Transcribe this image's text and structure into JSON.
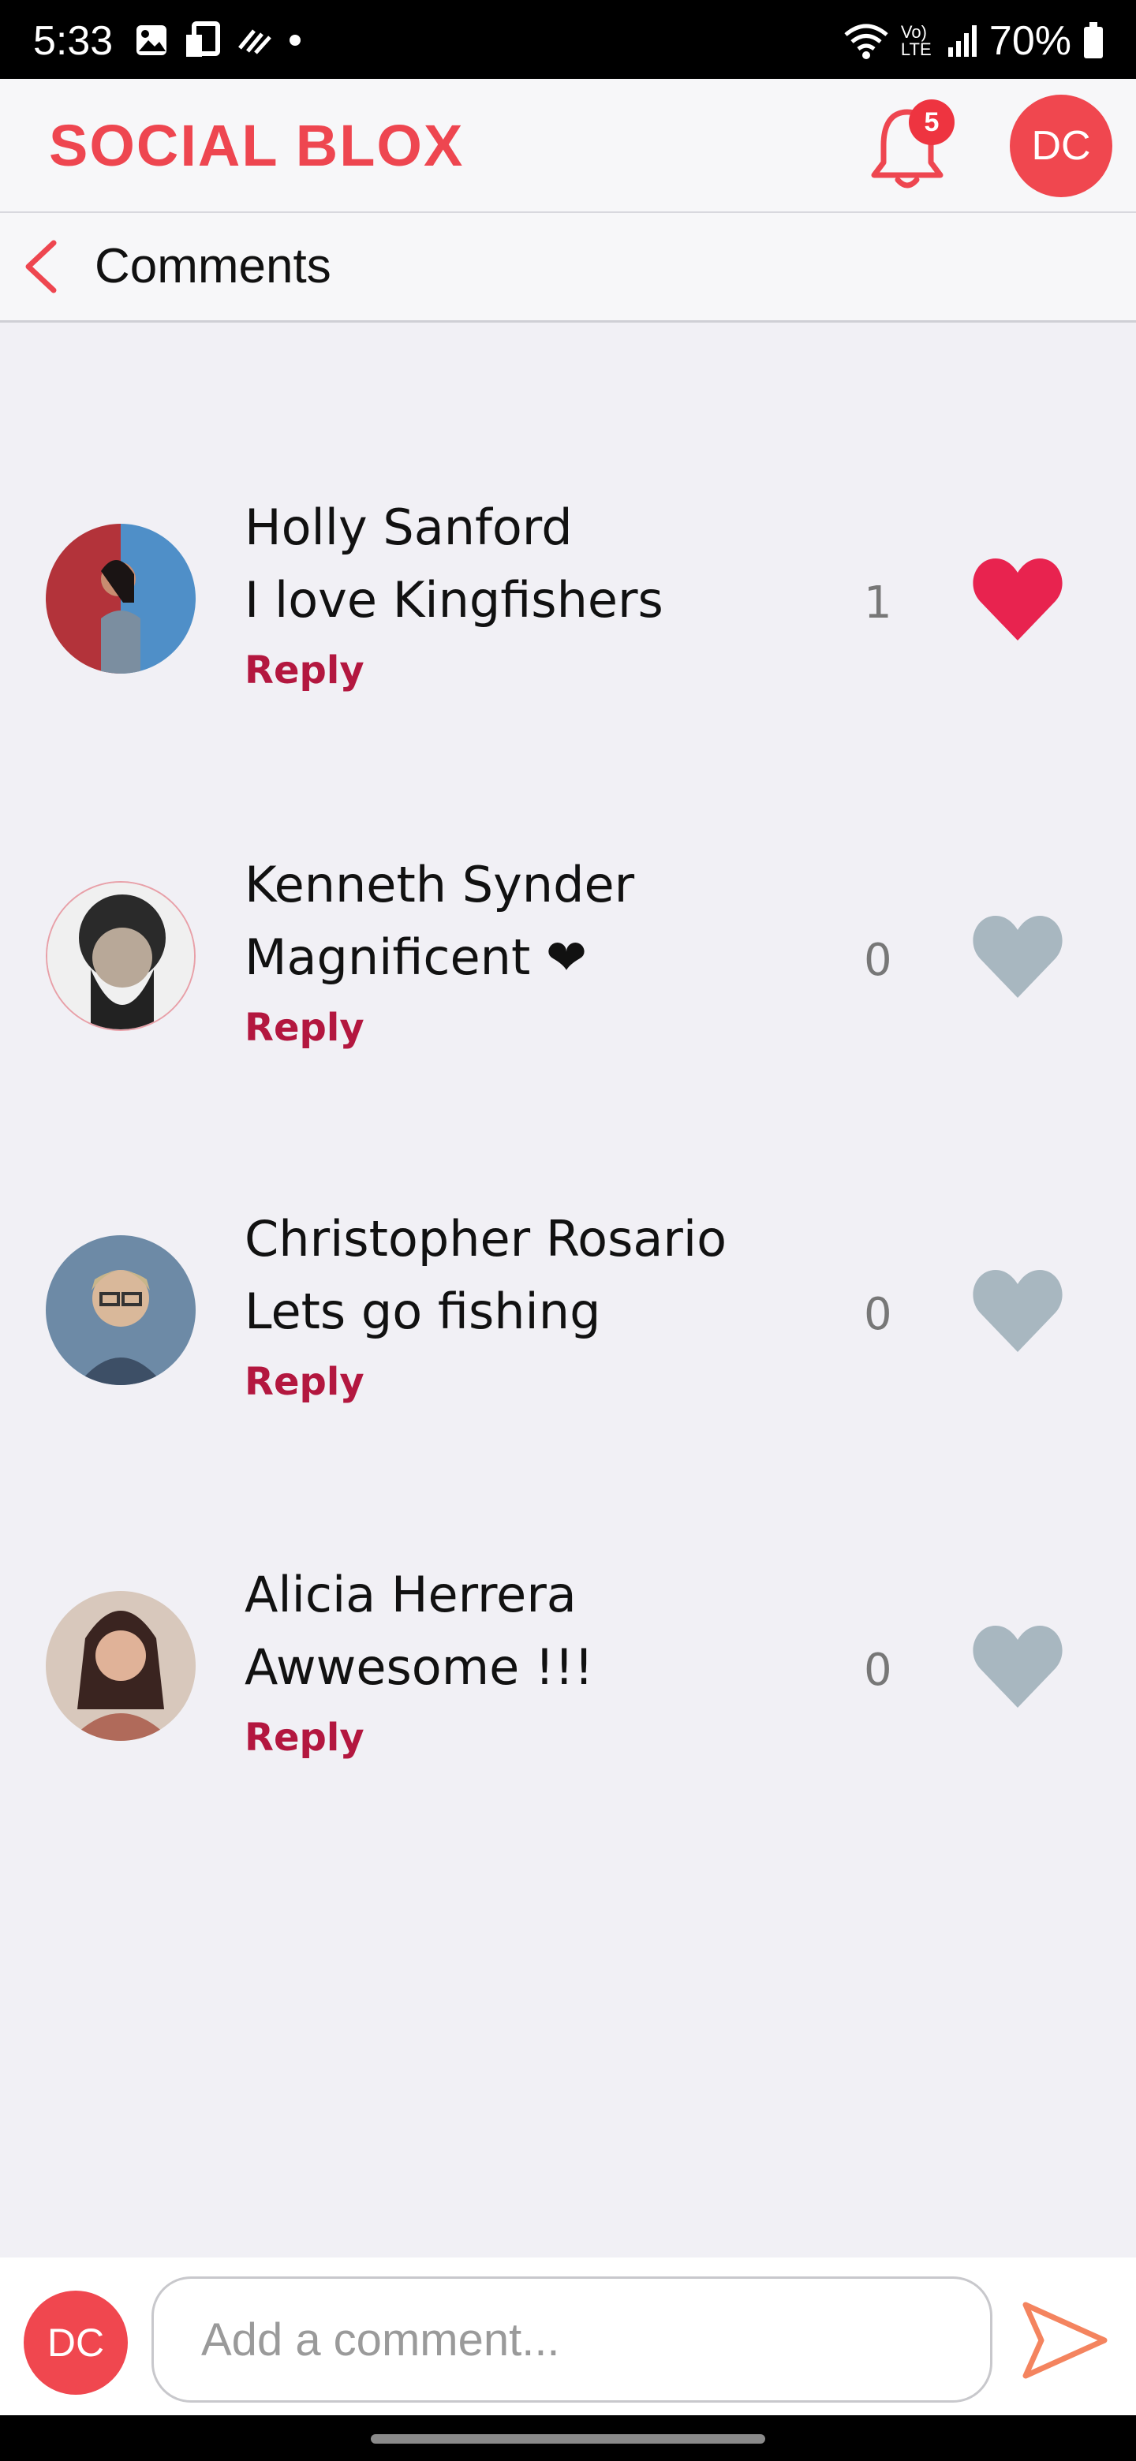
{
  "status": {
    "time": "5:33",
    "battery": "70%",
    "network": "Vo) LTE"
  },
  "header": {
    "logo": "SOCIAL BLOX",
    "notifications_count": "5",
    "user_initials": "DC"
  },
  "page": {
    "title": "Comments"
  },
  "comments": [
    {
      "name": "Holly Sanford",
      "text": "I love Kingfishers",
      "reply": "Reply",
      "likes": "1",
      "liked": true
    },
    {
      "name": "Kenneth Synder",
      "text": "Magnificent ❤",
      "reply": "Reply",
      "likes": "0",
      "liked": false
    },
    {
      "name": "Christopher Rosario",
      "text": "Lets go fishing",
      "reply": "Reply",
      "likes": "0",
      "liked": false
    },
    {
      "name": "Alicia Herrera",
      "text": "Awwesome !!!",
      "reply": "Reply",
      "likes": "0",
      "liked": false
    }
  ],
  "composer": {
    "user_initials": "DC",
    "placeholder": "Add a comment..."
  },
  "colors": {
    "brand": "#ee4650",
    "reply": "#b3173f",
    "heart_liked": "#e8234f",
    "heart_unliked": "#a8b7c0"
  }
}
